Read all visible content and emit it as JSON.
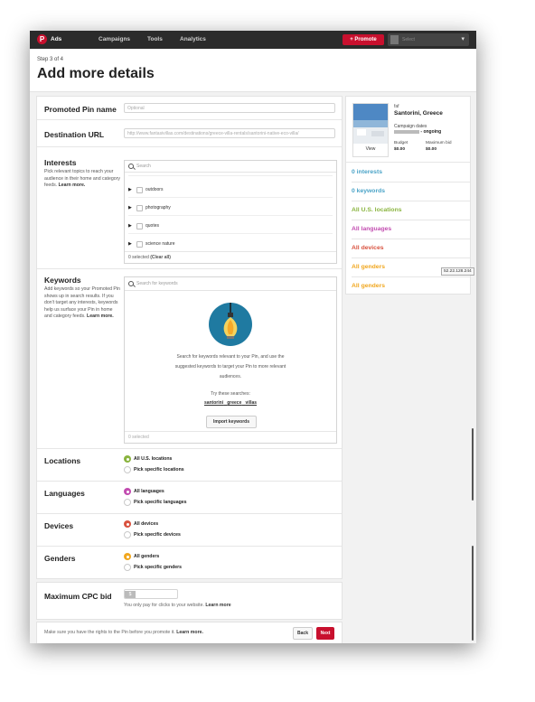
{
  "topbar": {
    "logo_letter": "P",
    "brand": "Ads",
    "nav": [
      "Campaigns",
      "Tools",
      "Analytics"
    ],
    "promote_label": "+ Promote",
    "account_placeholder": "Select"
  },
  "header": {
    "step": "Step 3 of 4",
    "title": "Add more details"
  },
  "form": {
    "pin_name_label": "Promoted Pin name",
    "pin_name_placeholder": "Optional",
    "dest_url_label": "Destination URL",
    "dest_url_value": "http://www.fantasivillas.com/destinations/greece-villa-rentals/santorini-native-eco-villa/",
    "interests": {
      "label": "Interests",
      "desc": "Pick relevant topics to reach your audience in their home and category feeds.",
      "learn_more": "Learn more.",
      "search_placeholder": "Search",
      "topics": [
        "outdoors",
        "photography",
        "quotes",
        "science nature"
      ],
      "selected_text": "0 selected",
      "clear_all": "(Clear all)"
    },
    "keywords": {
      "label": "Keywords",
      "desc": "Add keywords so your Promoted Pin shows up in search results. If you don't target any interests, keywords help us surface your Pin in home and category feeds.",
      "learn_more": "Learn more.",
      "search_placeholder": "Search for keywords",
      "message_line1": "Search for keywords relevant to your Pin, and use the",
      "message_line2": "suggested keywords to target your Pin to more relevant",
      "message_line3": "audiences.",
      "try_label": "Try these searches:",
      "tries": [
        "santorini",
        "greece",
        "villas"
      ],
      "import_label": "Import keywords",
      "selected_text": "0 selected"
    },
    "locations": {
      "label": "Locations",
      "opt1": "All U.S. locations",
      "opt2": "Pick specific locations"
    },
    "languages": {
      "label": "Languages",
      "opt1": "All languages",
      "opt2": "Pick specific languages"
    },
    "devices": {
      "label": "Devices",
      "opt1": "All devices",
      "opt2": "Pick specific devices"
    },
    "genders": {
      "label": "Genders",
      "opt1": "All genders",
      "opt2": "Pick specific genders"
    },
    "cpc": {
      "label": "Maximum CPC bid",
      "currency": "$",
      "note": "You only pay for clicks to your website.",
      "learn_more": "Learn more"
    },
    "footer": {
      "note": "Make sure you have the rights to the Pin before you promote it.",
      "learn_more": "Learn more.",
      "back_label": "Back",
      "next_label": "Next"
    }
  },
  "sidebar": {
    "pin_label_small": "faf",
    "pin_title": "Santorini, Greece",
    "view_label": "View",
    "campaign_dates_label": "Campaign dates",
    "campaign_dates_value": "- ongoing",
    "budget_label": "Budget",
    "budget_value": "$0.00",
    "maxbid_label": "Maximum bid",
    "maxbid_value": "$0.00",
    "items": [
      {
        "text": "0 interests",
        "color": "#4aa3c7"
      },
      {
        "text": "0 keywords",
        "color": "#4aa3c7"
      },
      {
        "text": "All U.S. locations",
        "color": "#8ab43f"
      },
      {
        "text": "All languages",
        "color": "#c24cb0"
      },
      {
        "text": "All devices",
        "color": "#d9523f"
      },
      {
        "text": "All genders",
        "color": "#f1a71f"
      },
      {
        "text": "All genders",
        "color": "#f1a71f"
      }
    ],
    "tooltip": "52.22.128.244"
  },
  "colors": {
    "brand_red": "#c8102e",
    "locations_radio": "#8ab43f",
    "languages_radio": "#c24cb0",
    "devices_radio": "#d9523f",
    "genders_radio": "#f1a71f"
  }
}
